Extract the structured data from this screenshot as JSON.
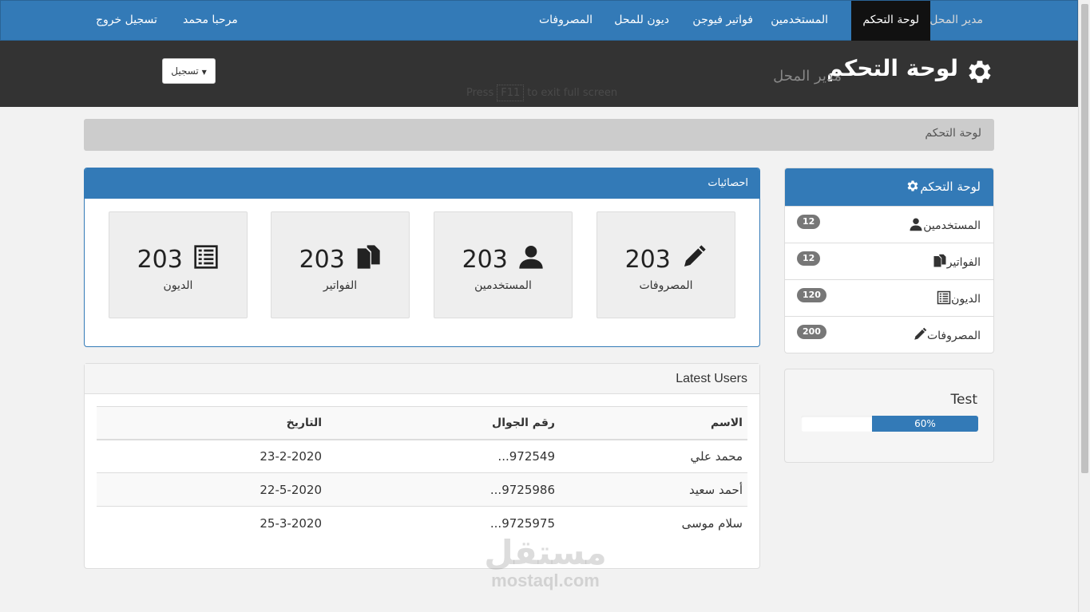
{
  "nav": {
    "brand": "مدير المحل",
    "items": [
      "لوحة التحكم",
      "المستخدمين",
      "فواتير فيوجن",
      "ديون للمحل",
      "المصروفات"
    ],
    "welcome": "مرحبا محمد",
    "logout": "تسجيل خروج"
  },
  "header": {
    "title": "لوحة التحكم",
    "subtitle": "مدير المحل",
    "fullscreen_hint_before": "Press",
    "fullscreen_hint_key": "F11",
    "fullscreen_hint_after": "to exit full screen",
    "dropdown_label": "تسجيل"
  },
  "breadcrumb": "لوحة التحكم",
  "sidebar": {
    "title": "لوحة التحكم",
    "items": [
      {
        "label": "المستخدمين",
        "badge": "12",
        "icon": "user-icon"
      },
      {
        "label": "الفواتير",
        "badge": "12",
        "icon": "files-icon"
      },
      {
        "label": "الديون",
        "badge": "120",
        "icon": "list-icon"
      },
      {
        "label": "المصروفات",
        "badge": "200",
        "icon": "pencil-icon"
      }
    ]
  },
  "progress": {
    "title": "Test",
    "value_percent": 60,
    "label": "60%"
  },
  "stats": {
    "title": "احصائيات",
    "cards": [
      {
        "value": "203",
        "label": "المصروفات",
        "icon": "pencil-icon"
      },
      {
        "value": "203",
        "label": "المستخدمين",
        "icon": "user-icon"
      },
      {
        "value": "203",
        "label": "الفواتير",
        "icon": "files-icon"
      },
      {
        "value": "203",
        "label": "الديون",
        "icon": "list-icon"
      }
    ]
  },
  "users": {
    "title": "Latest Users",
    "columns": [
      "الاسم",
      "رقم الجوال",
      "التاريخ"
    ],
    "rows": [
      [
        "محمد علي",
        "972549...",
        "23-2-2020"
      ],
      [
        "أحمد سعيد",
        "9725986...",
        "22-5-2020"
      ],
      [
        "سلام موسى",
        "9725975...",
        "25-3-2020"
      ]
    ]
  },
  "watermark": {
    "ar": "مستقل",
    "en": "mostaql.com"
  },
  "colors": {
    "primary": "#337ab7",
    "dark": "#333333",
    "active_nav": "#111111"
  }
}
